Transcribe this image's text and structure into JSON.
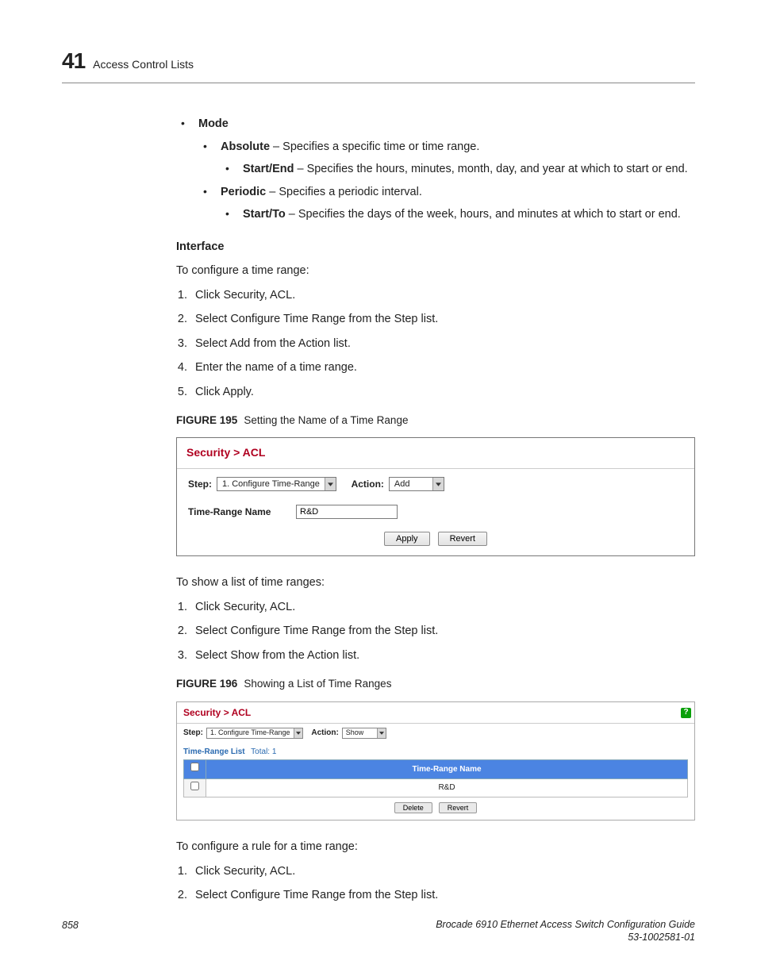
{
  "header": {
    "chapter_num": "41",
    "chapter_title": "Access Control Lists"
  },
  "mode": {
    "label": "Mode",
    "absolute": {
      "label": "Absolute",
      "desc": " – Specifies a specific time or time range."
    },
    "startend": {
      "label": "Start/End",
      "desc": " – Specifies the hours, minutes, month, day, and year at which to start or end."
    },
    "periodic": {
      "label": "Periodic",
      "desc": " – Specifies a periodic interval."
    },
    "startto": {
      "label": "Start/To",
      "desc": " – Specifies the days of the week, hours, and minutes at which to start or end."
    }
  },
  "interface": {
    "heading": "Interface",
    "intro1": "To configure a time range:",
    "steps1": [
      "Click Security, ACL.",
      "Select Configure Time Range from the Step list.",
      "Select Add from the Action list.",
      "Enter the name of a time range.",
      "Click Apply."
    ],
    "intro2": "To show a list of time ranges:",
    "steps2": [
      "Click Security, ACL.",
      "Select Configure Time Range from the Step list.",
      "Select Show from the Action list."
    ],
    "intro3": "To configure a rule for a time range:",
    "steps3": [
      "Click Security, ACL.",
      "Select Configure Time Range from the Step list."
    ]
  },
  "fig195": {
    "label_bold": "FIGURE 195",
    "label_text": "Setting the Name of a Time Range",
    "breadcrumb": "Security > ACL",
    "step_label": "Step:",
    "step_value": "1. Configure Time-Range",
    "action_label": "Action:",
    "action_value": "Add",
    "name_label": "Time-Range Name",
    "name_value": "R&D",
    "apply": "Apply",
    "revert": "Revert"
  },
  "fig196": {
    "label_bold": "FIGURE 196",
    "label_text": "Showing a List of Time Ranges",
    "breadcrumb": "Security > ACL",
    "help": "?",
    "step_label": "Step:",
    "step_value": "1. Configure Time-Range",
    "action_label": "Action:",
    "action_value": "Show",
    "list_label": "Time-Range List",
    "total": "Total: 1",
    "col_header": "Time-Range Name",
    "rows": [
      "R&D"
    ],
    "delete": "Delete",
    "revert": "Revert"
  },
  "footer": {
    "page": "858",
    "doc": "Brocade 6910 Ethernet Access Switch Configuration Guide",
    "docnum": "53-1002581-01"
  }
}
